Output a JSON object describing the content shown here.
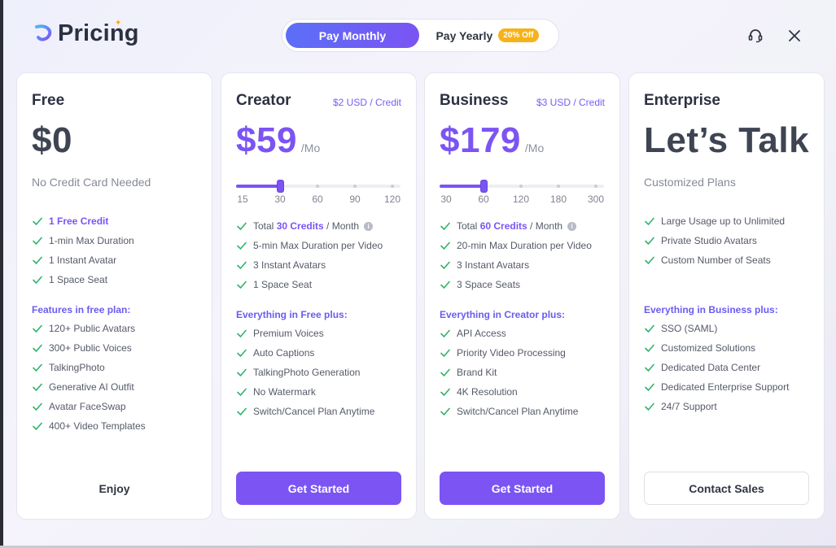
{
  "header": {
    "title": "Pricing",
    "toggle": {
      "monthly_label": "Pay Monthly",
      "yearly_label": "Pay Yearly",
      "yearly_discount": "20% Off",
      "selected": "monthly"
    },
    "support_icon": "headset-icon",
    "close_icon": "close-icon"
  },
  "colors": {
    "accent": "#7b54f3",
    "check": "#2fb36b",
    "badge": "#f6b21a"
  },
  "plans": [
    {
      "name": "Free",
      "price": "$0",
      "subtitle": "No Credit Card Needed",
      "features": [
        {
          "text": "1 Free Credit",
          "highlight": true
        },
        {
          "text": "1-min Max Duration"
        },
        {
          "text": "1 Instant Avatar"
        },
        {
          "text": "1 Space Seat"
        }
      ],
      "section_label": "Features in free plan:",
      "extra_features": [
        "120+ Public Avatars",
        "300+ Public Voices",
        "TalkingPhoto",
        "Generative AI Outfit",
        "Avatar FaceSwap",
        "400+ Video Templates"
      ],
      "cta": "Enjoy"
    },
    {
      "name": "Creator",
      "credit_price": "$2 USD / Credit",
      "price": "$59",
      "per": "/Mo",
      "slider": {
        "ticks": [
          "15",
          "30",
          "60",
          "90",
          "120"
        ],
        "selected_index": 1
      },
      "credits_line": {
        "prefix": "Total ",
        "value": "30 Credits",
        "suffix": " / Month"
      },
      "features": [
        "5-min Max Duration per Video",
        "3 Instant Avatars",
        "1 Space Seat"
      ],
      "section_label": "Everything in Free plus:",
      "extra_features": [
        "Premium Voices",
        "Auto Captions",
        "TalkingPhoto Generation",
        "No Watermark",
        "Switch/Cancel Plan Anytime"
      ],
      "cta": "Get Started"
    },
    {
      "name": "Business",
      "credit_price": "$3 USD / Credit",
      "price": "$179",
      "per": "/Mo",
      "slider": {
        "ticks": [
          "30",
          "60",
          "120",
          "180",
          "300"
        ],
        "selected_index": 1
      },
      "credits_line": {
        "prefix": "Total ",
        "value": "60 Credits",
        "suffix": " / Month"
      },
      "features": [
        "20-min Max Duration per Video",
        "3 Instant Avatars",
        "3 Space Seats"
      ],
      "section_label": "Everything in Creator plus:",
      "extra_features": [
        "API Access",
        "Priority Video Processing",
        "Brand Kit",
        "4K Resolution",
        "Switch/Cancel Plan Anytime"
      ],
      "cta": "Get Started"
    },
    {
      "name": "Enterprise",
      "price": "Let’s Talk",
      "subtitle": "Customized Plans",
      "features": [
        "Large Usage up to Unlimited",
        "Private Studio Avatars",
        "Custom Number of Seats"
      ],
      "section_label": "Everything in Business plus:",
      "extra_features": [
        "SSO (SAML)",
        "Customized Solutions",
        "Dedicated Data Center",
        "Dedicated Enterprise Support",
        "24/7 Support"
      ],
      "cta": "Contact Sales"
    }
  ]
}
